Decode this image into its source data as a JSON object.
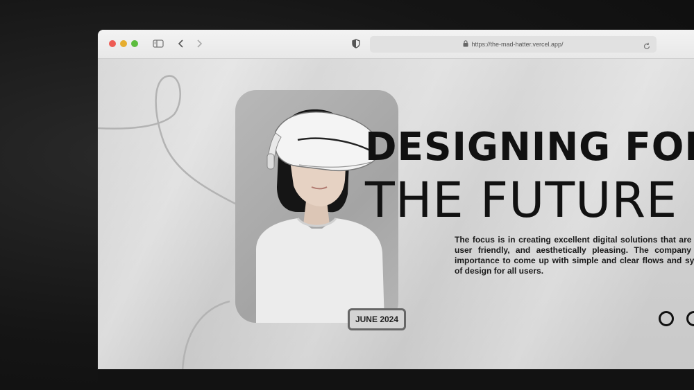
{
  "browser": {
    "url": "https://the-mad-hatter.vercel.app/",
    "icons": {
      "sidebar": "sidebar-icon",
      "back": "chevron-left-icon",
      "forward": "chevron-right-icon",
      "privacy": "shield-icon",
      "lock": "lock-icon",
      "reload": "reload-icon"
    },
    "colors": {
      "close": "#ee5b54",
      "minimize": "#e6ad2e",
      "maximize": "#5cbc3e"
    }
  },
  "hero": {
    "headline_line1": "DESIGNING FOR",
    "headline_line2": "THE FUTURE",
    "body": "The focus is in creating excellent digital solutions that are clean, user friendly, and aesthetically pleasing. The company gives importance to come up with simple and clear flows and systems of design for all users.",
    "date_badge": "JUNE 2024",
    "image": "woman-vr-headset-photo"
  }
}
